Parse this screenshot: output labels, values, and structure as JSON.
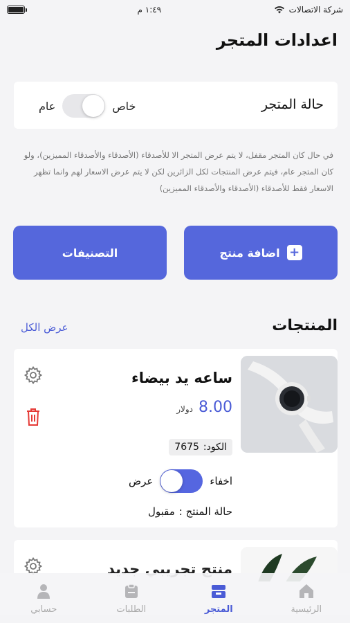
{
  "status_bar": {
    "carrier": "شركة الاتصالات",
    "time": "١:٤٩ م"
  },
  "page_title": "اعدادات المتجر",
  "store_status": {
    "label": "حالة المتجر",
    "option_private": "خاص",
    "option_public": "عام",
    "selected": "خاص"
  },
  "note": "في حال كان المتجر مقفل، لا يتم عرض المتجر الا للأصدقاء (الأصدقاء والأصدقاء المميزين)، ولو كان المتجر عام، فيتم عرض المنتجات لكل الزائرين لكن لا يتم عرض الاسعار لهم وانما تظهر الاسعار فقط للأصدقاء (الأصدقاء والأصدقاء المميزين)",
  "actions": {
    "add_product": "اضافة منتج",
    "categories": "التصنيفات"
  },
  "products_section": {
    "title": "المنتجات",
    "see_all": "عرض الكل"
  },
  "products": [
    {
      "name": "ساعه يد بيضاء",
      "price": "8.00",
      "currency": "دولار",
      "code_label": "الكود:",
      "code": "7675",
      "hide_label": "اخفاء",
      "show_label": "عرض",
      "visible": true,
      "status_label": "حالة المنتج :",
      "status": "مقبول"
    },
    {
      "name": "منتج تجريبي جديد"
    }
  ],
  "tabs": [
    {
      "label": "الرئيسية",
      "icon": "home-icon",
      "active": false
    },
    {
      "label": "المتجر",
      "icon": "store-icon",
      "active": true
    },
    {
      "label": "الطلبات",
      "icon": "orders-icon",
      "active": false
    },
    {
      "label": "حسابي",
      "icon": "user-icon",
      "active": false
    }
  ],
  "colors": {
    "accent": "#5567dc",
    "danger": "#e53935",
    "background": "#f4f4f6"
  }
}
